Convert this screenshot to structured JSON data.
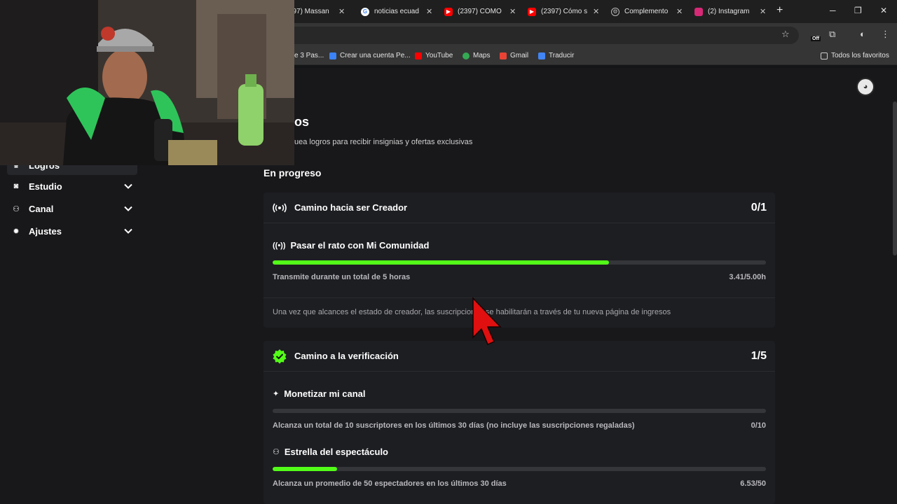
{
  "browser": {
    "tabs": [
      {
        "title": "(2397) Massan",
        "icon": "youtube-icon",
        "color": "#ff0000"
      },
      {
        "title": "noticias ecuad",
        "icon": "google-icon",
        "color": "#ffffff"
      },
      {
        "title": "(2397) CÓMO",
        "icon": "youtube-icon",
        "color": "#ff0000"
      },
      {
        "title": "(2397) Cómo s",
        "icon": "youtube-icon",
        "color": "#ff0000"
      },
      {
        "title": "Complemento",
        "icon": "extension-icon",
        "color": "#bbbbbb"
      },
      {
        "title": "(2) Instagram",
        "icon": "instagram-icon",
        "color": "#d62976"
      }
    ],
    "bookmarks": [
      {
        "label": "e 3 Pas..."
      },
      {
        "label": "Crear una cuenta Pe..."
      },
      {
        "label": "YouTube"
      },
      {
        "label": "Maps"
      },
      {
        "label": "Gmail"
      },
      {
        "label": "Traducir"
      }
    ],
    "all_favorites": "Todos los favoritos",
    "off_badge": "Off"
  },
  "sidebar": {
    "items": [
      {
        "label": "Logros",
        "icon": "trophy-icon",
        "expandable": false,
        "active": true
      },
      {
        "label": "Estudio",
        "icon": "studio-icon",
        "expandable": true
      },
      {
        "label": "Canal",
        "icon": "channel-icon",
        "expandable": true
      },
      {
        "label": "Ajustes",
        "icon": "gear-icon",
        "expandable": true
      }
    ]
  },
  "main": {
    "title": "os",
    "subtitle": "uea logros para recibir insignias y ofertas exclusivas",
    "section_title": "En progreso",
    "cards": [
      {
        "title": "Camino hacia ser Creador",
        "icon": "broadcast-icon",
        "count": "0/1",
        "tasks": [
          {
            "title": "Pasar el rato con Mi Comunidad",
            "icon": "broadcast-icon",
            "desc": "Transmite durante un total de 5 horas",
            "value": "3.41/5.00h",
            "progress": 0.682
          }
        ],
        "note": "Una vez que alcances el estado de creador, las suscripciones se habilitarán a través de tu nueva página de ingresos"
      },
      {
        "title": "Camino a la verificación",
        "icon": "verified-icon",
        "count": "1/5",
        "tasks": [
          {
            "title": "Monetizar mi canal",
            "icon": "sparkle-icon",
            "desc": "Alcanza un total de 10 suscriptores en los últimos 30 días (no incluye las suscripciones regaladas)",
            "value": "0/10",
            "progress": 0
          },
          {
            "title": "Estrella del espectáculo",
            "icon": "users-icon",
            "desc": "Alcanza un promedio de 50 espectadores en los últimos 30 días",
            "value": "6.53/50",
            "progress": 0.1306
          }
        ]
      }
    ]
  },
  "colors": {
    "accent": "#53fc18",
    "background": "#18181b",
    "card": "#1d1e22"
  }
}
